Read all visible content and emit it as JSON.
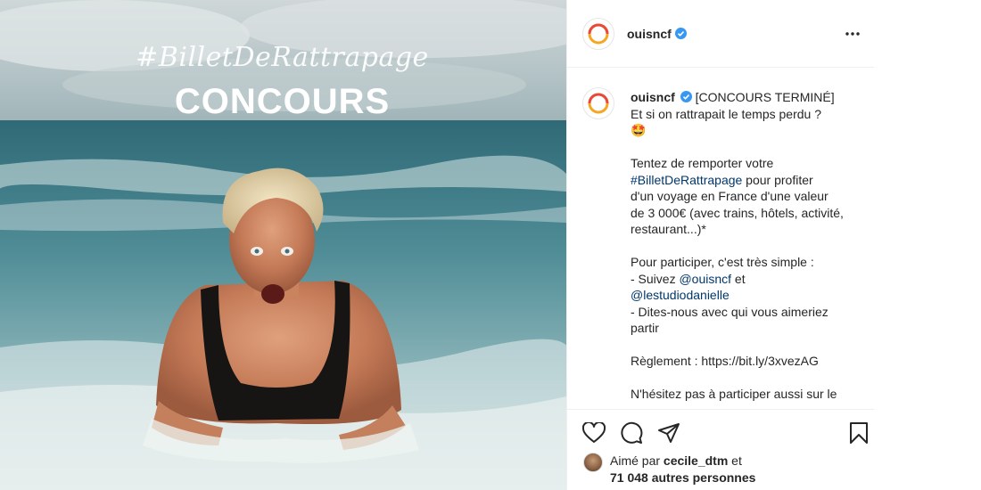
{
  "photo": {
    "hashtag": "#BilletDeRattrapage",
    "headline": "CONCOURS"
  },
  "post": {
    "username": "ouisncf",
    "verified": true,
    "more_icon": "more-horizontal-icon"
  },
  "caption": {
    "username": "ouisncf",
    "lines": {
      "l1": "[CONCOURS TERMINÉ]",
      "l2": "Et si on rattrapait le temps perdu ?",
      "l3": "🤩",
      "l4": "Tentez de remporter votre",
      "l5_link": "#BilletDeRattrapage",
      "l5_rest": " pour profiter",
      "l6": "d'un voyage en France d'une valeur",
      "l7": "de 3 000€ (avec trains, hôtels, activité,",
      "l8": "restaurant...)*",
      "l9": "Pour participer, c'est très simple :",
      "l10_pre": "- Suivez ",
      "l10_link": "@ouisncf",
      "l10_post": " et",
      "l11_link": "@lestudiodanielle",
      "l12": "- Dites-nous avec qui vous aimeriez",
      "l13": "partir",
      "l14": "Règlement : https://bit.ly/3xvezAG",
      "l15": "N'hésitez pas à participer aussi sur le"
    }
  },
  "actions": {
    "like_icon": "heart-icon",
    "comment_icon": "comment-icon",
    "share_icon": "share-icon",
    "save_icon": "bookmark-icon"
  },
  "likes": {
    "prefix": "Aimé par ",
    "user": "cecile_dtm",
    "and": " et",
    "others": "71 048 autres personnes"
  },
  "colors": {
    "link": "#00376b",
    "verified": "#3897f0",
    "logo_ring": "#f5a623"
  }
}
